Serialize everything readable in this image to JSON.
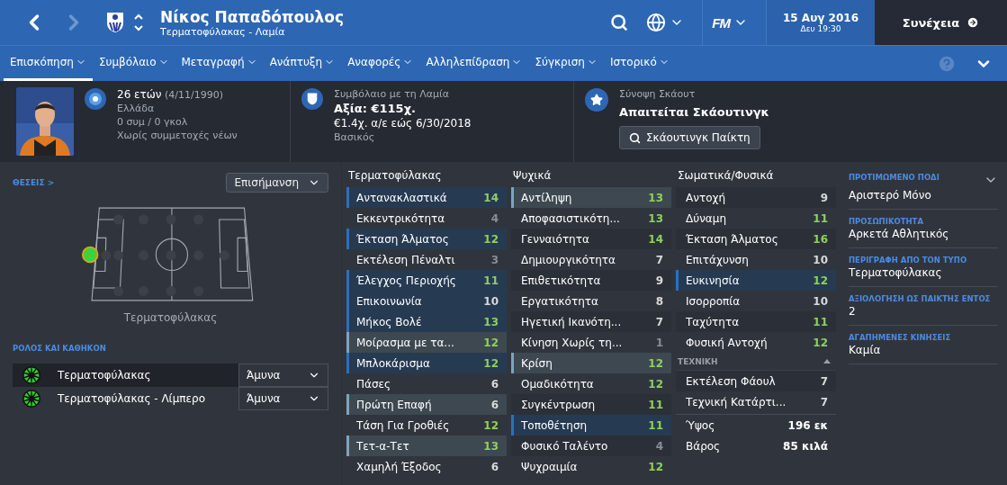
{
  "header": {
    "name": "Νίκος Παπαδόπουλος",
    "subtitle": "Τερματοφύλακας - Λαμία",
    "logo": "FM",
    "date": "15 Αυγ 2016",
    "time": "Δευ 19:30",
    "continue": "Συνέχεια"
  },
  "tabs": [
    {
      "label": "Επισκόπηση",
      "selected": true
    },
    {
      "label": "Συμβόλαιο",
      "selected": false
    },
    {
      "label": "Μεταγραφή",
      "selected": false
    },
    {
      "label": "Ανάπτυξη",
      "selected": false
    },
    {
      "label": "Αναφορές",
      "selected": false
    },
    {
      "label": "Αλληλεπίδραση",
      "selected": false
    },
    {
      "label": "Σύγκριση",
      "selected": false
    },
    {
      "label": "Ιστορικό",
      "selected": false
    }
  ],
  "profile": {
    "age": "26 ετών",
    "dob": "(4/11/1990)",
    "nation": "Ελλάδα",
    "caps": "0 συμ / 0 γκολ",
    "youth": "Χωρίς συμμετοχές νέων"
  },
  "contract": {
    "title": "Συμβόλαιο με τη Λαμία",
    "value": "Αξία: €115χ.",
    "wage": "€1.4χ. α/ε εώς 6/30/2018",
    "status": "Βασικός"
  },
  "scout": {
    "title": "Σύνοψη Σκάουτ",
    "status": "Απαιτείται Σκάουτινγκ",
    "button": "Σκάουτινγκ Παίκτη"
  },
  "positions": {
    "link": "ΘΕΣΕΙΣ",
    "link_arrow": ">",
    "dropdown": "Επισήμανση",
    "caption": "Τερματοφύλακας"
  },
  "roles": {
    "heading": "ΡΟΛΟΣ ΚΑΙ ΚΑΘΗΚΟΝ",
    "items": [
      {
        "name": "Τερματοφύλακας",
        "duty": "Άμυνα",
        "selected": true
      },
      {
        "name": "Τερματοφύλακας - Λίμπερο",
        "duty": "Άμυνα",
        "selected": false
      }
    ]
  },
  "attributes": [
    {
      "title": "Τερματοφύλακας",
      "rows": [
        {
          "name": "Αντανακλαστικά",
          "value": "14",
          "kind": "key"
        },
        {
          "name": "Εκκεντρικότητα",
          "value": "4",
          "kind": "plain"
        },
        {
          "name": "Έκταση Άλματος",
          "value": "12",
          "kind": "key"
        },
        {
          "name": "Εκτέλεση Πέναλτι",
          "value": "3",
          "kind": "plain"
        },
        {
          "name": "Έλεγχος Περιοχής",
          "value": "11",
          "kind": "key"
        },
        {
          "name": "Επικοινωνία",
          "value": "10",
          "kind": "key"
        },
        {
          "name": "Μήκος Βολέ",
          "value": "13",
          "kind": "key"
        },
        {
          "name": "Μοίρασμα με τα...",
          "value": "12",
          "kind": "extra"
        },
        {
          "name": "Μπλοκάρισμα",
          "value": "12",
          "kind": "key"
        },
        {
          "name": "Πάσες",
          "value": "6",
          "kind": "plain"
        },
        {
          "name": "Πρώτη Επαφή",
          "value": "6",
          "kind": "extra"
        },
        {
          "name": "Τάση Για Γροθιές",
          "value": "12",
          "kind": "plain"
        },
        {
          "name": "Τετ-α-Τετ",
          "value": "13",
          "kind": "extra"
        },
        {
          "name": "Χαμηλή Έξοδος",
          "value": "6",
          "kind": "plain"
        }
      ]
    },
    {
      "title": "Ψυχικά",
      "rows": [
        {
          "name": "Αντίληψη",
          "value": "13",
          "kind": "extra"
        },
        {
          "name": "Αποφασιστικότη...",
          "value": "13",
          "kind": "plain"
        },
        {
          "name": "Γενναιότητα",
          "value": "14",
          "kind": "plain"
        },
        {
          "name": "Δημιουργικότητα",
          "value": "7",
          "kind": "plain"
        },
        {
          "name": "Επιθετικότητα",
          "value": "9",
          "kind": "plain"
        },
        {
          "name": "Εργατικότητα",
          "value": "8",
          "kind": "plain"
        },
        {
          "name": "Ηγετική Ικανότη...",
          "value": "7",
          "kind": "plain"
        },
        {
          "name": "Κίνηση Χωρίς τη...",
          "value": "1",
          "kind": "plain"
        },
        {
          "name": "Κρίση",
          "value": "12",
          "kind": "extra"
        },
        {
          "name": "Ομαδικότητα",
          "value": "12",
          "kind": "plain"
        },
        {
          "name": "Συγκέντρωση",
          "value": "11",
          "kind": "plain"
        },
        {
          "name": "Τοποθέτηση",
          "value": "11",
          "kind": "key"
        },
        {
          "name": "Φυσικό Ταλέντο",
          "value": "4",
          "kind": "plain"
        },
        {
          "name": "Ψυχραιμία",
          "value": "12",
          "kind": "plain"
        }
      ]
    },
    {
      "title": "Σωματικά/Φυσικά",
      "rows": [
        {
          "name": "Αντοχή",
          "value": "9",
          "kind": "plain"
        },
        {
          "name": "Δύναμη",
          "value": "11",
          "kind": "plain"
        },
        {
          "name": "Έκταση Άλματος",
          "value": "16",
          "kind": "plain"
        },
        {
          "name": "Επιτάχυνση",
          "value": "10",
          "kind": "plain"
        },
        {
          "name": "Ευκινησία",
          "value": "12",
          "kind": "key"
        },
        {
          "name": "Ισορροπία",
          "value": "10",
          "kind": "plain"
        },
        {
          "name": "Ταχύτητα",
          "value": "11",
          "kind": "plain"
        },
        {
          "name": "Φυσική Αντοχή",
          "value": "12",
          "kind": "plain"
        }
      ],
      "section": {
        "title": "ΤΕΧΝΙΚΗ",
        "expanded": true,
        "rows": [
          {
            "name": "Εκτέλεση Φάουλ",
            "value": "7"
          },
          {
            "name": "Τεχνική Κατάρτι...",
            "value": "7"
          }
        ]
      },
      "measures": [
        {
          "label": "Ύψος",
          "value": "196 εκ"
        },
        {
          "label": "Βάρος",
          "value": "85 κιλά"
        }
      ]
    }
  ],
  "details": [
    {
      "label": "ΠΡΟΤΙΜΩΜΕΝΟ ΠΟΔΙ",
      "value": "Αριστερό Μόνο"
    },
    {
      "label": "ΠΡΟΣΩΠΙΚΟΤΗΤΑ",
      "value": "Αρκετά Αθλητικός"
    },
    {
      "label": "ΠΕΡΙΓΡΑΦΗ ΑΠΟ ΤΟΝ ΤΥΠΟ",
      "value": "Τερματοφύλακας"
    },
    {
      "label": "ΑΞΙΟΛΟΓΗΣΗ ΩΣ ΠΑΙΚΤΗΣ ΕΝΤΟΣ",
      "value": "2"
    },
    {
      "label": "ΑΓΑΠΗΜΕΝΕΣ ΚΙΝΗΣΕΙΣ",
      "value": "Καμία"
    }
  ]
}
